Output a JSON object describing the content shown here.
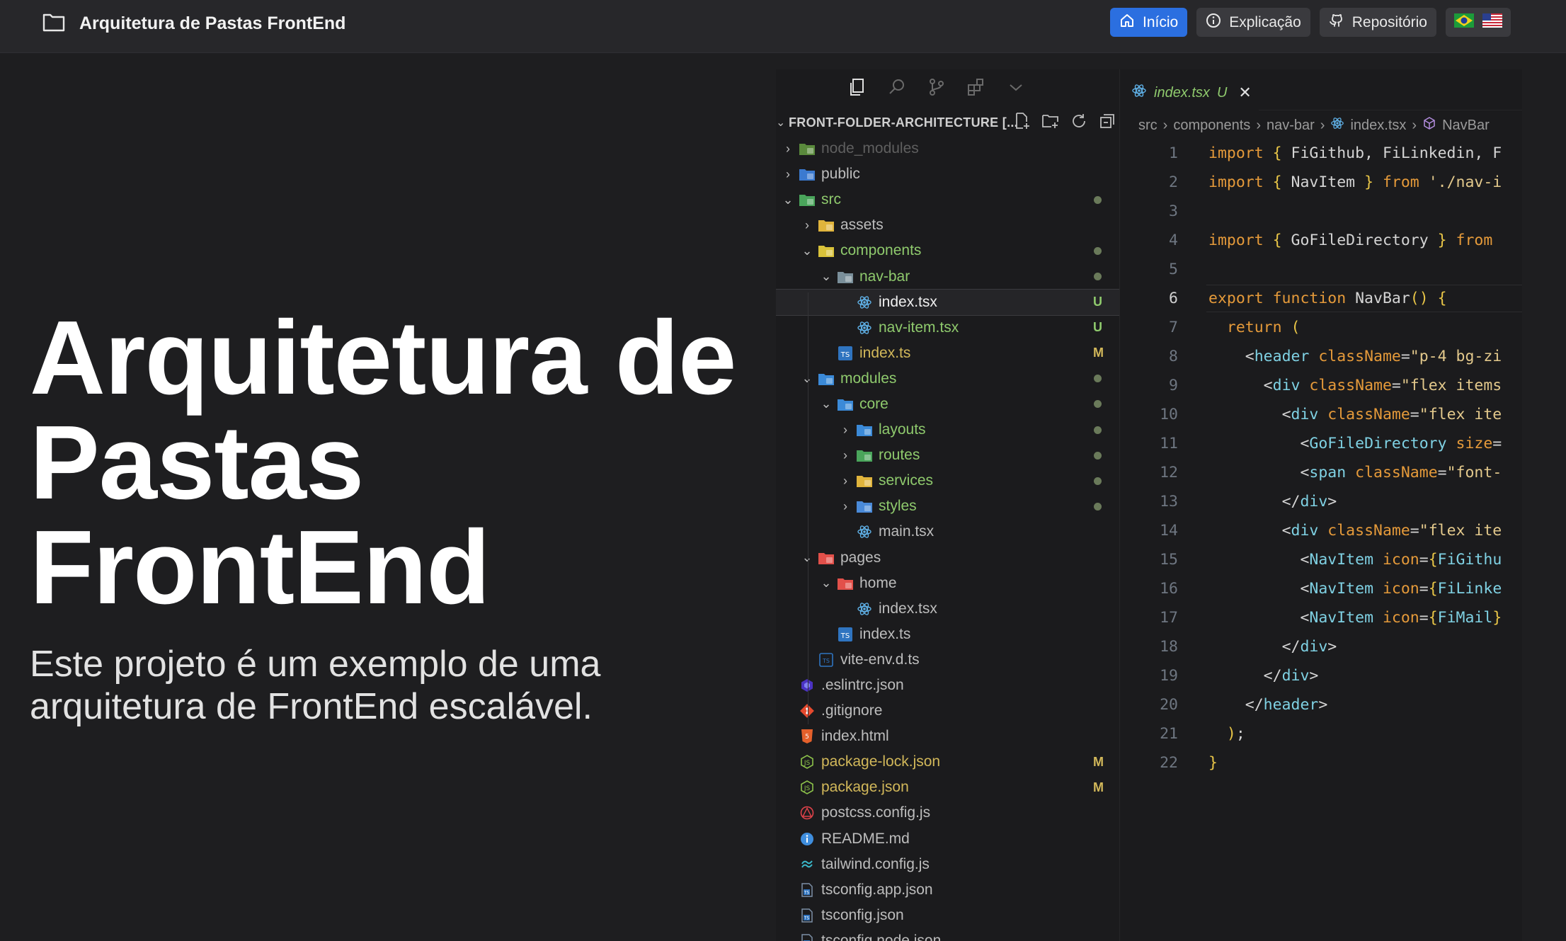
{
  "header": {
    "title": "Arquitetura de Pastas FrontEnd",
    "nav": [
      {
        "label": "Início",
        "icon": "home-icon",
        "active": true
      },
      {
        "label": "Explicação",
        "icon": "info-icon",
        "active": false
      },
      {
        "label": "Repositório",
        "icon": "github-icon",
        "active": false
      }
    ],
    "languages": [
      "pt-BR",
      "en-US"
    ]
  },
  "hero": {
    "title": "Arquitetura de Pastas FrontEnd",
    "subtitle": "Este projeto é um exemplo de uma arquitetura de FrontEnd escalável."
  },
  "explorer": {
    "title": "FRONT-FOLDER-ARCHITECTURE [...",
    "items": [
      {
        "label": "node_modules",
        "depth": 0,
        "chev": "›",
        "status": "",
        "dot": false,
        "color": "dim",
        "icon": "folder-node-icon"
      },
      {
        "label": "public",
        "depth": 0,
        "chev": "›",
        "status": "",
        "dot": false,
        "color": "gray",
        "icon": "folder-public-icon"
      },
      {
        "label": "src",
        "depth": 0,
        "chev": "⌄",
        "status": "",
        "dot": true,
        "color": "green",
        "icon": "folder-src-icon"
      },
      {
        "label": "assets",
        "depth": 1,
        "chev": "›",
        "status": "",
        "dot": false,
        "color": "gray",
        "icon": "folder-assets-icon"
      },
      {
        "label": "components",
        "depth": 1,
        "chev": "⌄",
        "status": "",
        "dot": true,
        "color": "green",
        "icon": "folder-components-icon"
      },
      {
        "label": "nav-bar",
        "depth": 2,
        "chev": "⌄",
        "status": "",
        "dot": true,
        "color": "green",
        "icon": "folder-open-icon"
      },
      {
        "label": "index.tsx",
        "depth": 3,
        "chev": "",
        "status": "U",
        "dot": false,
        "color": "white",
        "icon": "react-icon",
        "selected": true
      },
      {
        "label": "nav-item.tsx",
        "depth": 3,
        "chev": "",
        "status": "U",
        "dot": false,
        "color": "green",
        "icon": "react-icon"
      },
      {
        "label": "index.ts",
        "depth": 2,
        "chev": "",
        "status": "M",
        "dot": false,
        "color": "yellow",
        "icon": "typescript-icon"
      },
      {
        "label": "modules",
        "depth": 1,
        "chev": "⌄",
        "status": "",
        "dot": true,
        "color": "green",
        "icon": "folder-modules-icon"
      },
      {
        "label": "core",
        "depth": 2,
        "chev": "⌄",
        "status": "",
        "dot": true,
        "color": "green",
        "icon": "folder-core-icon"
      },
      {
        "label": "layouts",
        "depth": 3,
        "chev": "›",
        "status": "",
        "dot": true,
        "color": "green",
        "icon": "folder-layouts-icon"
      },
      {
        "label": "routes",
        "depth": 3,
        "chev": "›",
        "status": "",
        "dot": true,
        "color": "green",
        "icon": "folder-routes-icon"
      },
      {
        "label": "services",
        "depth": 3,
        "chev": "›",
        "status": "",
        "dot": true,
        "color": "green",
        "icon": "folder-services-icon"
      },
      {
        "label": "styles",
        "depth": 3,
        "chev": "›",
        "status": "",
        "dot": true,
        "color": "green",
        "icon": "folder-styles-icon"
      },
      {
        "label": "main.tsx",
        "depth": 3,
        "chev": "",
        "status": "",
        "dot": false,
        "color": "gray",
        "icon": "react-icon"
      },
      {
        "label": "pages",
        "depth": 1,
        "chev": "⌄",
        "status": "",
        "dot": false,
        "color": "gray",
        "icon": "folder-pages-icon"
      },
      {
        "label": "home",
        "depth": 2,
        "chev": "⌄",
        "status": "",
        "dot": false,
        "color": "gray",
        "icon": "folder-home-icon"
      },
      {
        "label": "index.tsx",
        "depth": 3,
        "chev": "",
        "status": "",
        "dot": false,
        "color": "gray",
        "icon": "react-icon"
      },
      {
        "label": "index.ts",
        "depth": 2,
        "chev": "",
        "status": "",
        "dot": false,
        "color": "gray",
        "icon": "typescript-icon"
      },
      {
        "label": "vite-env.d.ts",
        "depth": 1,
        "chev": "",
        "status": "",
        "dot": false,
        "color": "gray",
        "icon": "typescript-def-icon"
      },
      {
        "label": ".eslintrc.json",
        "depth": 0,
        "chev": "",
        "status": "",
        "dot": false,
        "color": "gray",
        "icon": "eslint-icon"
      },
      {
        "label": ".gitignore",
        "depth": 0,
        "chev": "",
        "status": "",
        "dot": false,
        "color": "gray",
        "icon": "git-icon"
      },
      {
        "label": "index.html",
        "depth": 0,
        "chev": "",
        "status": "",
        "dot": false,
        "color": "gray",
        "icon": "html-icon"
      },
      {
        "label": "package-lock.json",
        "depth": 0,
        "chev": "",
        "status": "M",
        "dot": false,
        "color": "yellow",
        "icon": "npm-icon"
      },
      {
        "label": "package.json",
        "depth": 0,
        "chev": "",
        "status": "M",
        "dot": false,
        "color": "yellow",
        "icon": "npm-icon"
      },
      {
        "label": "postcss.config.js",
        "depth": 0,
        "chev": "",
        "status": "",
        "dot": false,
        "color": "gray",
        "icon": "postcss-icon"
      },
      {
        "label": "README.md",
        "depth": 0,
        "chev": "",
        "status": "",
        "dot": false,
        "color": "gray",
        "icon": "info-icon"
      },
      {
        "label": "tailwind.config.js",
        "depth": 0,
        "chev": "",
        "status": "",
        "dot": false,
        "color": "gray",
        "icon": "tailwind-icon"
      },
      {
        "label": "tsconfig.app.json",
        "depth": 0,
        "chev": "",
        "status": "",
        "dot": false,
        "color": "gray",
        "icon": "tsconfig-icon"
      },
      {
        "label": "tsconfig.json",
        "depth": 0,
        "chev": "",
        "status": "",
        "dot": false,
        "color": "gray",
        "icon": "tsconfig-icon"
      },
      {
        "label": "tsconfig.node.json",
        "depth": 0,
        "chev": "",
        "status": "",
        "dot": false,
        "color": "gray",
        "icon": "tsconfig-icon"
      }
    ]
  },
  "editor": {
    "tab": {
      "label": "index.tsx",
      "status": "U"
    },
    "breadcrumb": [
      "src",
      "components",
      "nav-bar",
      "index.tsx",
      "NavBar"
    ],
    "current_line": 6,
    "lines": [
      [
        [
          "kw",
          "import "
        ],
        [
          "br",
          "{ "
        ],
        [
          "id",
          "FiGithub, FiLinkedin, F"
        ]
      ],
      [
        [
          "kw",
          "import "
        ],
        [
          "br",
          "{ "
        ],
        [
          "id",
          "NavItem "
        ],
        [
          "br",
          "} "
        ],
        [
          "kw",
          "from "
        ],
        [
          "st",
          "'./nav-i"
        ]
      ],
      [],
      [
        [
          "kw",
          "import "
        ],
        [
          "br",
          "{ "
        ],
        [
          "id",
          "GoFileDirectory "
        ],
        [
          "br",
          "} "
        ],
        [
          "kw",
          "from"
        ]
      ],
      [],
      [
        [
          "kw",
          "export function "
        ],
        [
          "id",
          "NavBar"
        ],
        [
          "br",
          "() {"
        ]
      ],
      [
        [
          "id",
          "  "
        ],
        [
          "kw",
          "return "
        ],
        [
          "br",
          "("
        ]
      ],
      [
        [
          "id",
          "    "
        ],
        [
          "id",
          "<"
        ],
        [
          "tg",
          "header "
        ],
        [
          "at",
          "className"
        ],
        [
          "id",
          "="
        ],
        [
          "st",
          "\"p-4 bg-zi"
        ]
      ],
      [
        [
          "id",
          "      "
        ],
        [
          "id",
          "<"
        ],
        [
          "tg",
          "div "
        ],
        [
          "at",
          "className"
        ],
        [
          "id",
          "="
        ],
        [
          "st",
          "\"flex items"
        ]
      ],
      [
        [
          "id",
          "        "
        ],
        [
          "id",
          "<"
        ],
        [
          "tg",
          "div "
        ],
        [
          "at",
          "className"
        ],
        [
          "id",
          "="
        ],
        [
          "st",
          "\"flex ite"
        ]
      ],
      [
        [
          "id",
          "          "
        ],
        [
          "id",
          "<"
        ],
        [
          "tg",
          "GoFileDirectory "
        ],
        [
          "at",
          "size"
        ],
        [
          "id",
          "="
        ]
      ],
      [
        [
          "id",
          "          "
        ],
        [
          "id",
          "<"
        ],
        [
          "tg",
          "span "
        ],
        [
          "at",
          "className"
        ],
        [
          "id",
          "="
        ],
        [
          "st",
          "\"font-"
        ]
      ],
      [
        [
          "id",
          "        "
        ],
        [
          "id",
          "</"
        ],
        [
          "tg",
          "div"
        ],
        [
          "id",
          ">"
        ]
      ],
      [
        [
          "id",
          "        "
        ],
        [
          "id",
          "<"
        ],
        [
          "tg",
          "div "
        ],
        [
          "at",
          "className"
        ],
        [
          "id",
          "="
        ],
        [
          "st",
          "\"flex ite"
        ]
      ],
      [
        [
          "id",
          "          "
        ],
        [
          "id",
          "<"
        ],
        [
          "tg",
          "NavItem "
        ],
        [
          "at",
          "icon"
        ],
        [
          "id",
          "="
        ],
        [
          "br",
          "{"
        ],
        [
          "tg",
          "FiGithu"
        ]
      ],
      [
        [
          "id",
          "          "
        ],
        [
          "id",
          "<"
        ],
        [
          "tg",
          "NavItem "
        ],
        [
          "at",
          "icon"
        ],
        [
          "id",
          "="
        ],
        [
          "br",
          "{"
        ],
        [
          "tg",
          "FiLinke"
        ]
      ],
      [
        [
          "id",
          "          "
        ],
        [
          "id",
          "<"
        ],
        [
          "tg",
          "NavItem "
        ],
        [
          "at",
          "icon"
        ],
        [
          "id",
          "="
        ],
        [
          "br",
          "{"
        ],
        [
          "tg",
          "FiMail"
        ],
        [
          "br",
          "}"
        ]
      ],
      [
        [
          "id",
          "        "
        ],
        [
          "id",
          "</"
        ],
        [
          "tg",
          "div"
        ],
        [
          "id",
          ">"
        ]
      ],
      [
        [
          "id",
          "      "
        ],
        [
          "id",
          "</"
        ],
        [
          "tg",
          "div"
        ],
        [
          "id",
          ">"
        ]
      ],
      [
        [
          "id",
          "    "
        ],
        [
          "id",
          "</"
        ],
        [
          "tg",
          "header"
        ],
        [
          "id",
          ">"
        ]
      ],
      [
        [
          "id",
          "  "
        ],
        [
          "br",
          ")"
        ],
        [
          "id",
          ";"
        ]
      ],
      [
        [
          "br",
          "}"
        ]
      ]
    ]
  }
}
